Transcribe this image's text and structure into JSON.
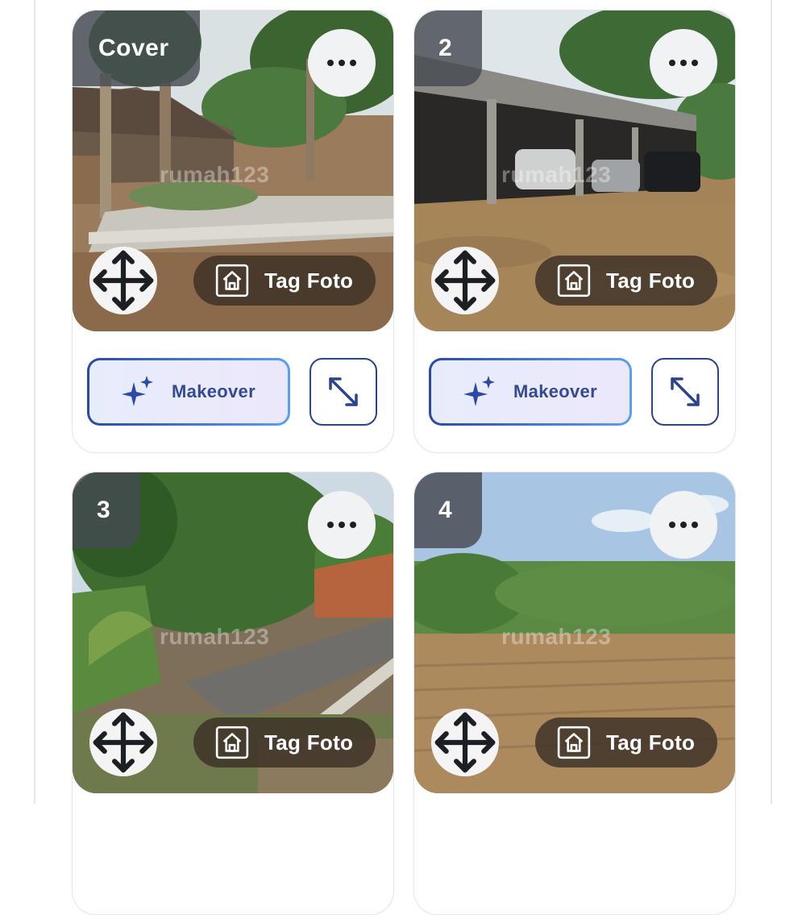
{
  "cards": [
    {
      "badge": "Cover",
      "watermark": "rumah123",
      "tag_label": "Tag Foto",
      "makeover_label": "Makeover"
    },
    {
      "badge": "2",
      "watermark": "rumah123",
      "tag_label": "Tag Foto",
      "makeover_label": "Makeover"
    },
    {
      "badge": "3",
      "watermark": "rumah123",
      "tag_label": "Tag Foto"
    },
    {
      "badge": "4",
      "watermark": "rumah123",
      "tag_label": "Tag Foto"
    }
  ],
  "icons": {
    "more": "more-horizontal-icon",
    "move": "move-arrows-icon",
    "tag": "house-tag-icon",
    "makeover": "sparkle-icon",
    "expand": "expand-diagonal-icon"
  },
  "colors": {
    "makeover_text": "#334a94",
    "expand_border": "#2c4488",
    "badge_bg": "#464a50",
    "tag_bg": "#3c3026"
  }
}
